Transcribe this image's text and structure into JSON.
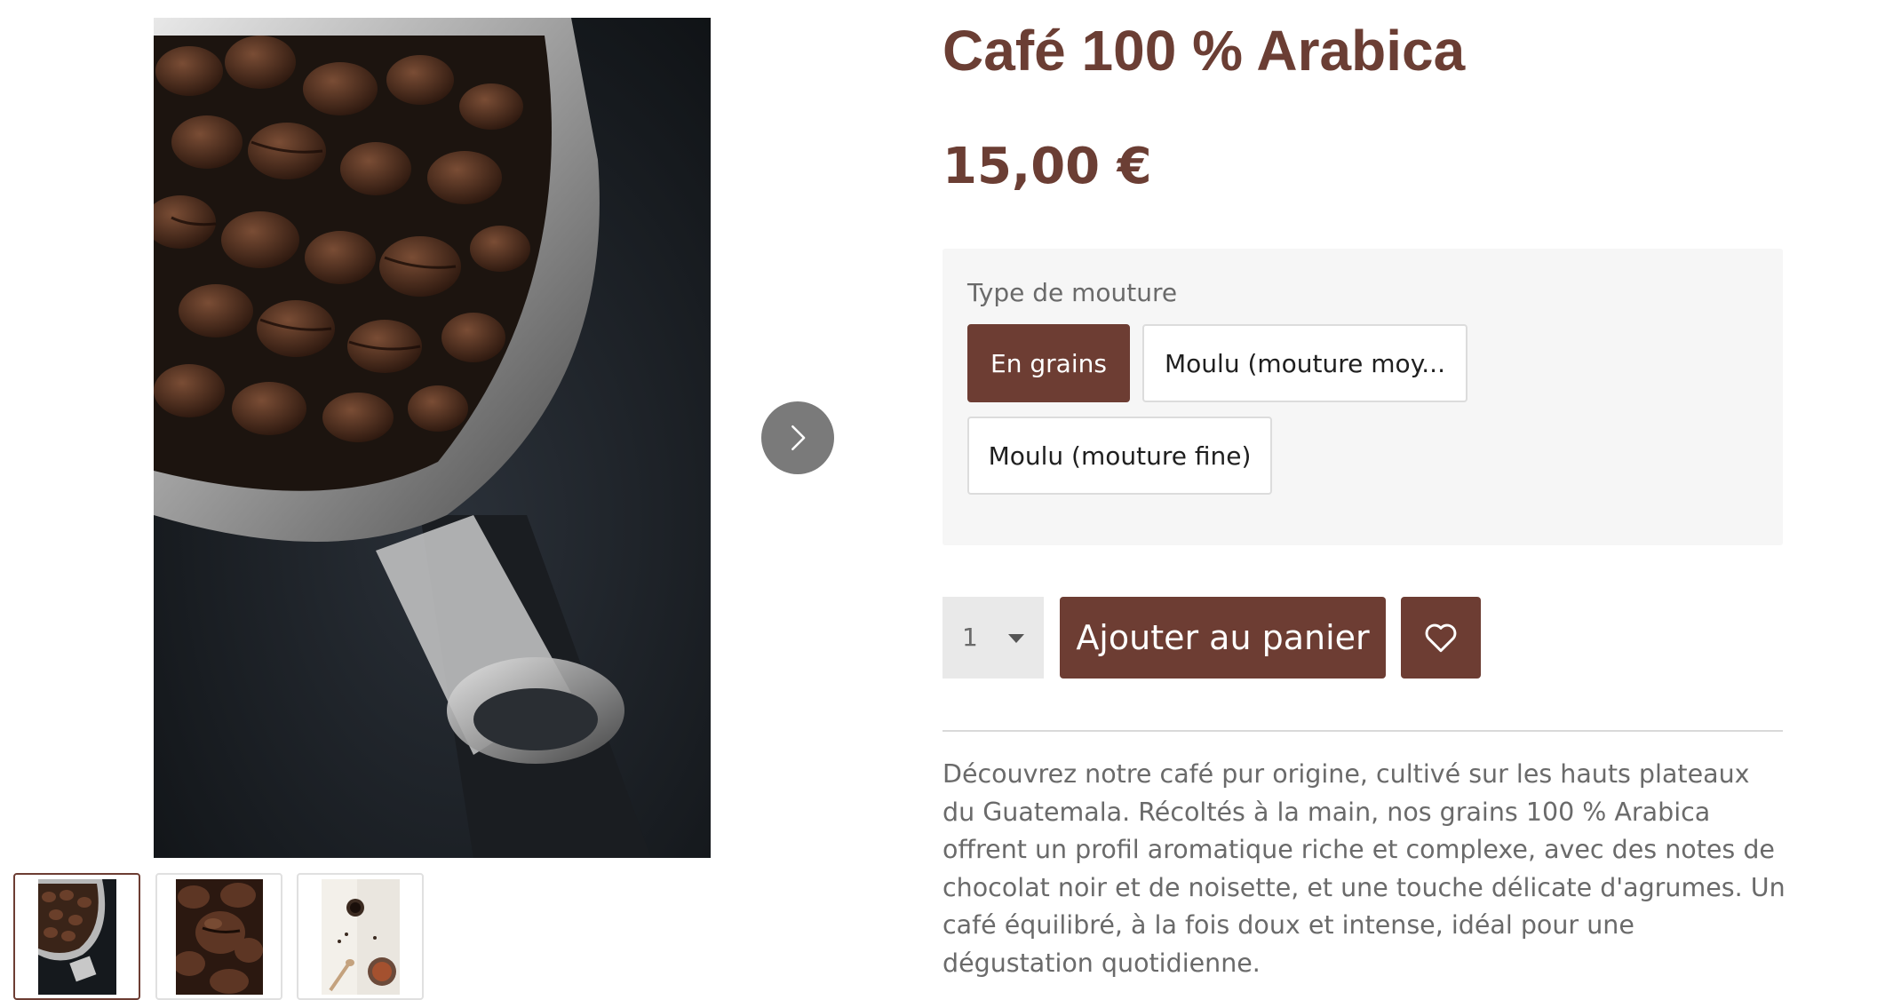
{
  "gallery": {
    "next_icon": "chevron-right-icon",
    "thumbnails": [
      {
        "alt": "portafilter-beans-thumb",
        "active": true
      },
      {
        "alt": "beans-closeup-thumb",
        "active": false
      },
      {
        "alt": "espresso-table-thumb",
        "active": false
      }
    ]
  },
  "product": {
    "title": "Café 100 % Arabica",
    "price": "15,00 €",
    "variant": {
      "label": "Type de mouture",
      "options": [
        {
          "label": "En grains",
          "selected": true
        },
        {
          "label": "Moulu (mouture moy...",
          "selected": false
        },
        {
          "label": "Moulu (mouture fine)",
          "selected": false
        }
      ]
    },
    "quantity": "1",
    "add_to_cart_label": "Ajouter au panier",
    "wishlist_icon": "heart-icon",
    "description": "Découvrez notre café pur origine, cultivé sur les hauts plateaux du Guatemala. Récoltés à la main, nos grains 100 % Arabica offrent un profil aromatique riche et complexe, avec des notes de chocolat noir et de noisette, et une touche délicate d'agrumes. Un café équilibré, à la fois doux et intense, idéal pour une dégustation quotidienne."
  },
  "colors": {
    "brand": "#6d3d33",
    "title": "#6b3e34",
    "panel_bg": "#f6f6f6",
    "text": "#6a6a6a"
  }
}
